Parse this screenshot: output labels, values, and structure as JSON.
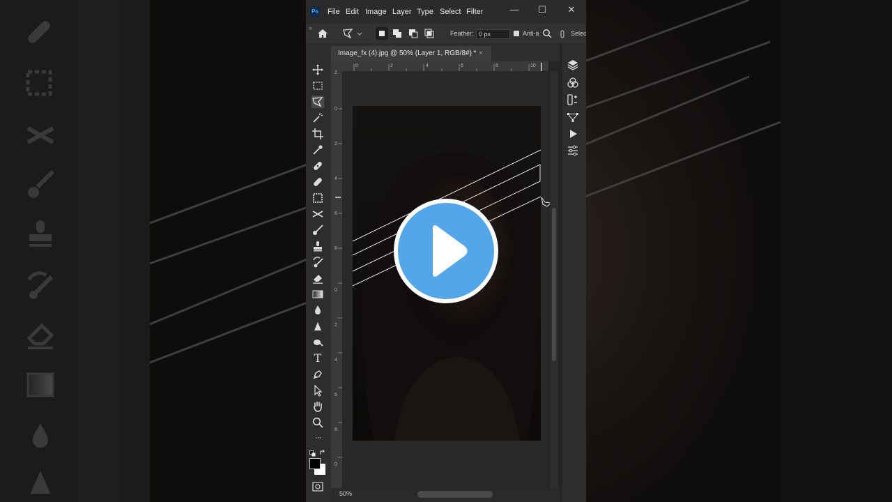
{
  "app": {
    "logo": "Ps",
    "menu": [
      "File",
      "Edit",
      "Image",
      "Layer",
      "Type",
      "Select",
      "Filter"
    ],
    "window_controls": {
      "minimize": "—",
      "maximize": "☐",
      "close": "✕"
    }
  },
  "options_bar": {
    "feather_label": "Feather:",
    "feather_value": "0 px",
    "antialias_label": "Anti-a",
    "select_label": "Selec"
  },
  "panel_collapse": "»",
  "document": {
    "tab_title": "Image_fx (4).jpg @ 50% (Layer 1, RGB/8#) *",
    "tab_close": "×",
    "zoom": "50%"
  },
  "ruler_h_labels": [
    "0",
    "2",
    "4",
    "6",
    "8",
    "10"
  ],
  "ruler_v_labels": [
    "2",
    "0",
    "2",
    "4",
    "6",
    "8",
    "0",
    "2",
    "4",
    "6",
    "8",
    "0"
  ],
  "tools": [
    "move-icon",
    "marquee-icon",
    "polygonal-lasso-icon",
    "magic-wand-icon",
    "crop-icon",
    "eyedropper-icon",
    "spot-healing-icon",
    "healing-brush-icon",
    "patch-icon",
    "content-aware-move-icon",
    "brush-icon",
    "clone-stamp-icon",
    "history-brush-icon",
    "eraser-icon",
    "gradient-icon",
    "blur-icon",
    "sharpen-icon",
    "dodge-icon",
    "type-icon",
    "pen-icon",
    "path-selection-icon",
    "hand-icon",
    "zoom-icon",
    "more-tools-icon"
  ],
  "type_tool_glyph": "T",
  "more_tools_glyph": "···",
  "panels": [
    "layers-icon",
    "channels-icon",
    "adjustments-icon",
    "paths-icon",
    "actions-icon",
    "properties-icon"
  ],
  "colors": {
    "accent_play": "#53a6ea",
    "window_bg": "#252525",
    "toolbar_bg": "#2d2d2d"
  }
}
